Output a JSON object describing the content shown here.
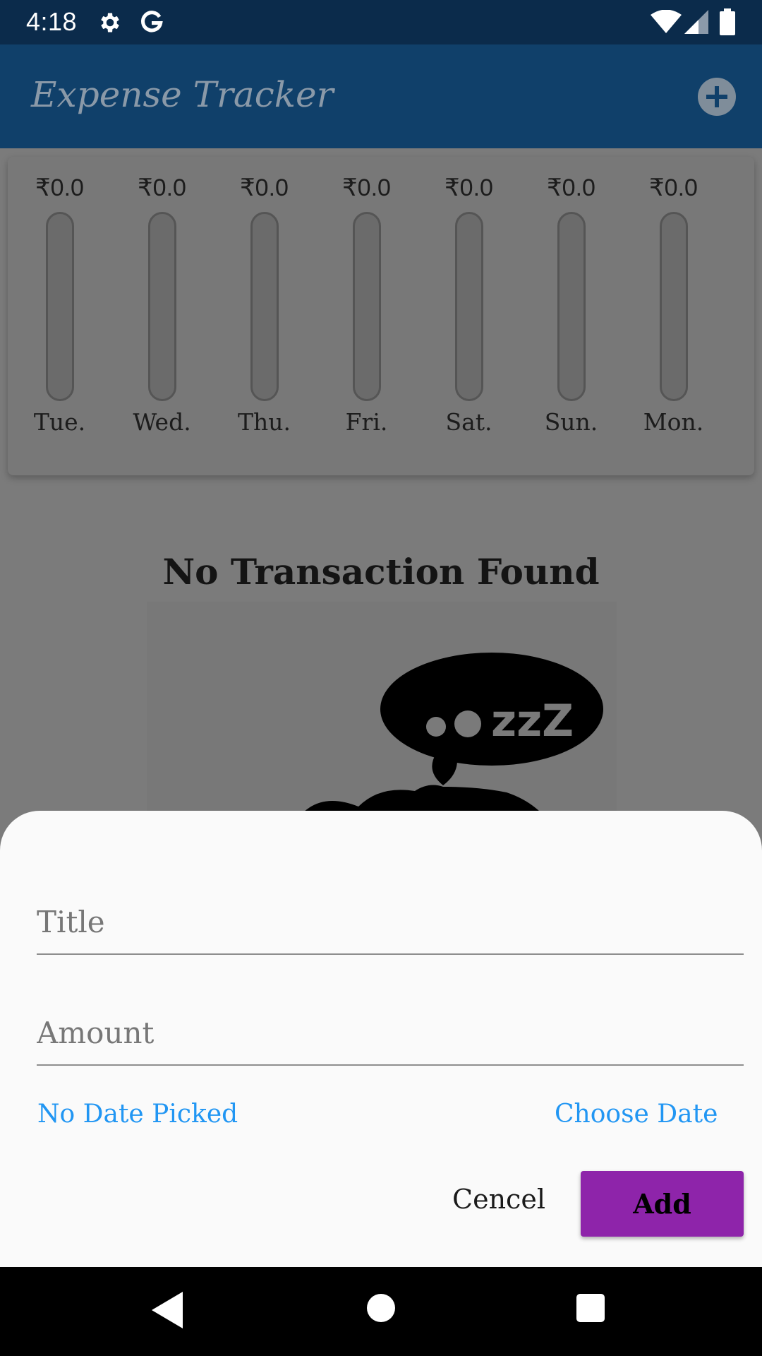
{
  "status_bar": {
    "time": "4:18"
  },
  "app_bar": {
    "title": "Expense Tracker",
    "add_icon": "plus-circle-icon"
  },
  "chart_data": {
    "type": "bar",
    "categories": [
      "Tue.",
      "Wed.",
      "Thu.",
      "Fri.",
      "Sat.",
      "Sun.",
      "Mon."
    ],
    "values": [
      0.0,
      0.0,
      0.0,
      0.0,
      0.0,
      0.0,
      0.0
    ],
    "value_labels": [
      "₹0.0",
      "₹0.0",
      "₹0.0",
      "₹0.0",
      "₹0.0",
      "₹0.0",
      "₹0.0"
    ],
    "ylim": [
      0,
      1
    ],
    "fill_color": "#7a1c8c",
    "grid": false
  },
  "empty_state": {
    "title": "No Transaction Found",
    "image_text": "zzZ"
  },
  "sheet": {
    "title_placeholder": "Title",
    "amount_placeholder": "Amount",
    "date_status": "No Date Picked",
    "choose_date_label": "Choose Date",
    "cancel_label": "Cencel",
    "add_label": "Add",
    "accent_color": "#2196f3",
    "primary_color": "#8e24aa"
  }
}
